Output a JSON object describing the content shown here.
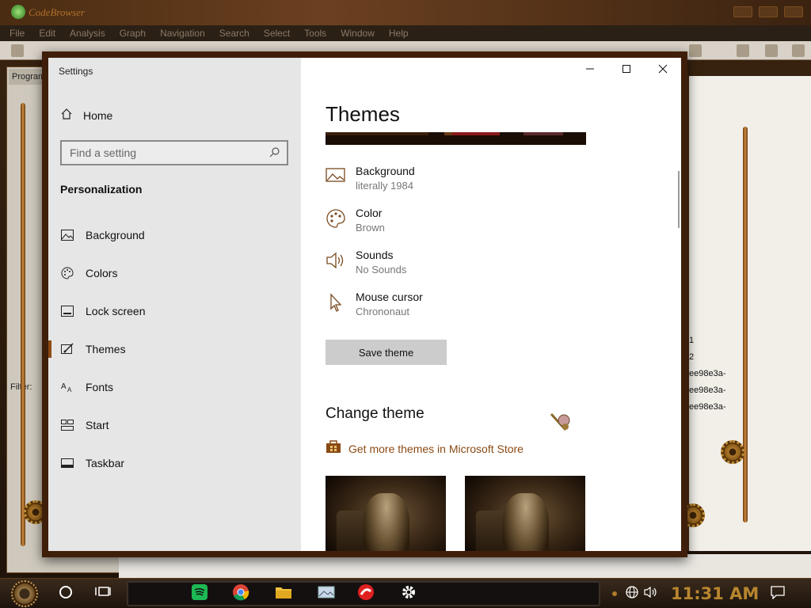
{
  "background_app": {
    "title": "CodeBrowser",
    "menu": [
      "File",
      "Edit",
      "Analysis",
      "Graph",
      "Navigation",
      "Search",
      "Select",
      "Tools",
      "Window",
      "Help"
    ],
    "left_tab": "Program",
    "filter_label": "Filter:",
    "right_rows": [
      "1",
      "2",
      "ee98e3a-",
      "ee98e3a-",
      "ee98e3a-"
    ]
  },
  "settings": {
    "window_title": "Settings",
    "home_label": "Home",
    "search_placeholder": "Find a setting",
    "section": "Personalization",
    "nav": [
      {
        "label": "Background",
        "icon": "picture-icon"
      },
      {
        "label": "Colors",
        "icon": "palette-icon"
      },
      {
        "label": "Lock screen",
        "icon": "lock-screen-icon"
      },
      {
        "label": "Themes",
        "icon": "brush-icon",
        "active": true
      },
      {
        "label": "Fonts",
        "icon": "font-icon"
      },
      {
        "label": "Start",
        "icon": "start-icon"
      },
      {
        "label": "Taskbar",
        "icon": "taskbar-icon"
      }
    ],
    "page_title": "Themes",
    "properties": [
      {
        "name": "Background",
        "value": "literally 1984",
        "icon": "picture-icon"
      },
      {
        "name": "Color",
        "value": "Brown",
        "icon": "palette-icon"
      },
      {
        "name": "Sounds",
        "value": "No Sounds",
        "icon": "speaker-icon"
      },
      {
        "name": "Mouse cursor",
        "value": "Chrononaut",
        "icon": "cursor-icon"
      }
    ],
    "save_button": "Save theme",
    "change_theme_header": "Change theme",
    "store_link": "Get more themes in Microsoft Store",
    "accent_color": "#8a4a14"
  },
  "taskbar": {
    "clock": "11:31 AM",
    "pinned": [
      "spotify-icon",
      "chrome-icon",
      "folder-icon",
      "photos-icon",
      "app-icon",
      "settings-gear-icon"
    ]
  }
}
